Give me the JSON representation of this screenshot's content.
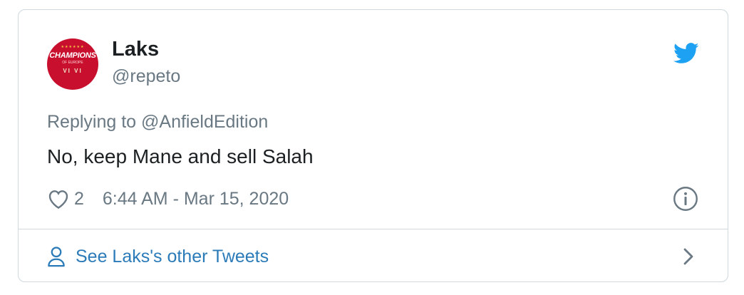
{
  "author": {
    "name": "Laks",
    "handle": "@repeto",
    "avatar": {
      "banner": "CHAMPIONS",
      "sub": "OF EUROPE",
      "cups": "VI VI",
      "stars": "★★★★★★",
      "icon": "liverpool-champions-avatar"
    }
  },
  "tweet": {
    "replying_prefix": "Replying to",
    "replying_to": "@AnfieldEdition",
    "text": "No, keep Mane and sell Salah",
    "like_count": "2",
    "timestamp": "6:44 AM - Mar 15, 2020"
  },
  "footer": {
    "label": "See Laks's other Tweets"
  },
  "icons": {
    "brand": "twitter-bird-icon",
    "like": "heart-icon",
    "info": "info-icon",
    "profile": "person-icon",
    "next": "chevron-right-icon"
  },
  "colors": {
    "twitter_blue": "#1da1f2",
    "link_blue": "#2b7bb9",
    "secondary_text": "#697882",
    "primary_text": "#1c2022",
    "border": "#cfd9de",
    "avatar_red": "#c8102e"
  }
}
